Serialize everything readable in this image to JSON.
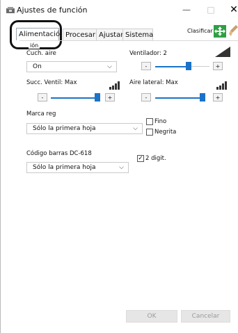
{
  "window": {
    "title": "Ajustes de función",
    "minimize": "—",
    "maximize": "□",
    "close": "✕"
  },
  "tabs": [
    {
      "label": "Alimentació"
    },
    {
      "label": "Procesar"
    },
    {
      "label": "Ajustar"
    },
    {
      "label": "Sistema"
    }
  ],
  "toolbar": {
    "clasificar": "Clasificar"
  },
  "group": {
    "label": "ión"
  },
  "cuch_aire": {
    "label": "Cuch. aire",
    "value": "On"
  },
  "ventilador": {
    "label": "Ventilador: 2",
    "level": 0.75
  },
  "succ_ventil": {
    "label": "Succ. Ventil: Max",
    "level": 1.0
  },
  "aire_lateral": {
    "label": "Aire lateral: Max",
    "level": 1.0
  },
  "marca_reg": {
    "label": "Marca reg",
    "value": "Sólo la primera hoja",
    "fino": "Fino",
    "negrita": "Negrita"
  },
  "codigo_barras": {
    "label": "Código barras DC-618",
    "value": "Sólo la primera hoja",
    "two_digit": "2 digit."
  },
  "buttons": {
    "minus": "-",
    "plus": "+",
    "ok": "OK",
    "cancel": "Cancelar"
  },
  "colors": {
    "accent": "#1a73c8",
    "green_icon": "#2ea043"
  }
}
